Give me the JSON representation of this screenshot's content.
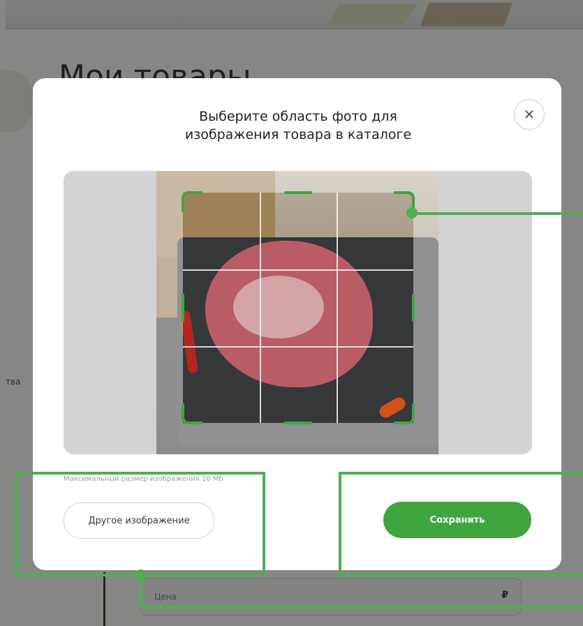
{
  "background": {
    "page_title": "Мои товары",
    "sidebar_fragment": "тва",
    "price_field": {
      "label": "Цена",
      "currency": "₽"
    }
  },
  "modal": {
    "title_line1": "Выберите область фото для",
    "title_line2": "изображения товара в каталоге",
    "close_icon": "close-icon",
    "hint": "Максимальный размер изображения 10 Мб",
    "other_image_button": "Другое изображение",
    "save_button": "Сохранить"
  },
  "colors": {
    "accent": "#3fa63f",
    "highlight": "#4caf50"
  }
}
